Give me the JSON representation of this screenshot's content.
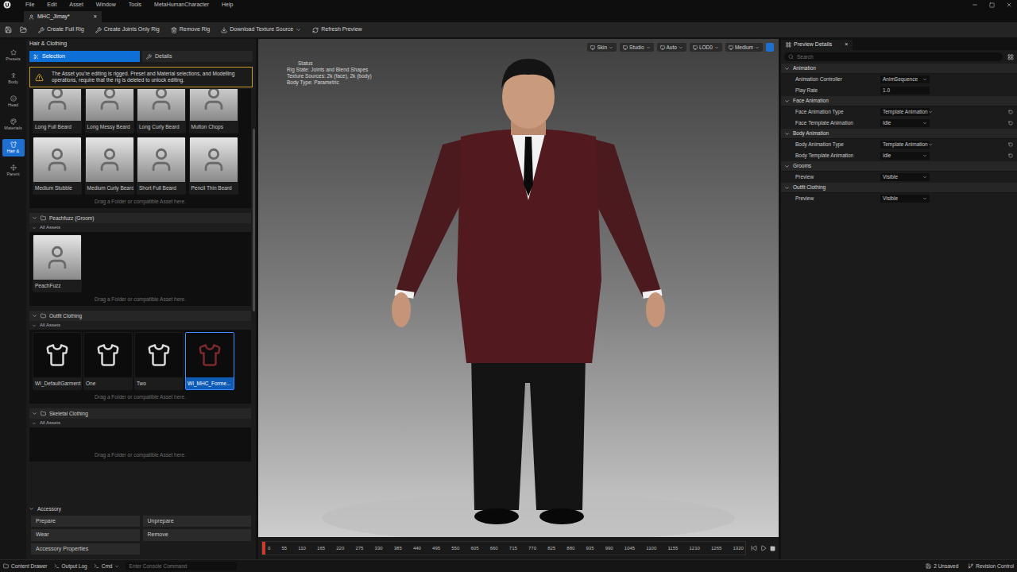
{
  "menu_bar": {
    "items": [
      "File",
      "Edit",
      "Asset",
      "Window",
      "Tools",
      "MetaHumanCharacter",
      "Help"
    ]
  },
  "document_tab": {
    "title": "MHC_Jimay*",
    "close": "×"
  },
  "toolbar": {
    "buttons": [
      {
        "label": "Create Full Rig",
        "dropdown": false
      },
      {
        "label": "Create Joints Only Rig",
        "dropdown": false
      },
      {
        "label": "Remove Rig",
        "dropdown": false
      },
      {
        "label": "Download Texture Source",
        "dropdown": true
      },
      {
        "label": "Refresh Preview",
        "dropdown": false
      }
    ]
  },
  "rail": [
    {
      "label": "Presets",
      "selected": false
    },
    {
      "label": "Body",
      "selected": false
    },
    {
      "label": "Head",
      "selected": false
    },
    {
      "label": "Materials",
      "selected": false
    },
    {
      "label": "Hair &",
      "selected": true
    },
    {
      "label": "Parent",
      "selected": false
    }
  ],
  "left_panel": {
    "title": "Hair & Clothing",
    "tabs": [
      {
        "label": "Selection",
        "selected": true
      },
      {
        "label": "Details",
        "selected": false
      }
    ],
    "warning": "The Asset you're editing is rigged. Preset and Material selections, and Modelling operations, require that the rig is deleted to unlock editing.",
    "beards": {
      "cards": [
        {
          "label": "Long Full Beard",
          "selected": false
        },
        {
          "label": "Long Messy Beard",
          "selected": false
        },
        {
          "label": "Long Curly Beard",
          "selected": false
        },
        {
          "label": "Mutton Chops",
          "selected": false
        },
        {
          "label": "Medium Stubble",
          "selected": false
        },
        {
          "label": "Medium Curly Beard",
          "selected": false
        },
        {
          "label": "Short Full Beard",
          "selected": false
        },
        {
          "label": "Pencil Thin Beard",
          "selected": false
        }
      ],
      "drop_hint": "Drag a Folder or compatible Asset here."
    },
    "sections": [
      {
        "title": "Peachfuzz (Groom)",
        "expanded": true,
        "group": "All Assets",
        "cards": [
          {
            "label": "PeachFuzz",
            "selected": false
          }
        ],
        "drop_hint": "Drag a Folder or compatible Asset here."
      },
      {
        "title": "Outfit Clothing",
        "expanded": true,
        "group": "All Assets",
        "cards": [
          {
            "label": "WI_DefaultGarment",
            "selected": false
          },
          {
            "label": "One",
            "selected": false
          },
          {
            "label": "Two",
            "selected": false
          },
          {
            "label": "WI_MHC_Forme...",
            "selected": true
          }
        ],
        "drop_hint": "Drag a Folder or compatible Asset here."
      },
      {
        "title": "Skeletal Clothing",
        "expanded": true,
        "group": "All Assets",
        "cards": [],
        "drop_hint": "Drag a Folder or compatible Asset here."
      }
    ],
    "accessory": {
      "title": "Accessory",
      "expanded": true,
      "buttons": [
        "Prepare",
        "Unprepare",
        "Wear",
        "Remove",
        "Accessory Properties"
      ]
    }
  },
  "viewport": {
    "toolbar": [
      {
        "label": "Skin"
      },
      {
        "label": "Studio"
      },
      {
        "label": "Auto"
      },
      {
        "label": "LOD0"
      },
      {
        "label": "Medium"
      }
    ],
    "status": {
      "title": "Status",
      "lines": [
        "Rig State: Joints and Blend Shapes",
        "Texture Sources: 2k (face), 2k (body)",
        "Body Type: Parametric"
      ]
    },
    "timeline": {
      "ticks": [
        "0",
        "55",
        "110",
        "165",
        "220",
        "275",
        "330",
        "385",
        "440",
        "495",
        "550",
        "605",
        "660",
        "715",
        "770",
        "825",
        "880",
        "935",
        "990",
        "1045",
        "1100",
        "1155",
        "1210",
        "1265",
        "1320"
      ],
      "level": 0.0
    }
  },
  "right_panel": {
    "tab": {
      "title": "Preview Details",
      "close": "×"
    },
    "search": {
      "placeholder": "Search"
    },
    "categories": [
      {
        "title": "Animation",
        "expanded": true,
        "rows": [
          {
            "label": "Animation Controller",
            "value": "AnimSequence",
            "kind": "dropdown",
            "resettable": false
          },
          {
            "label": "Play Rate",
            "value": "1.0",
            "kind": "number",
            "resettable": false
          }
        ]
      },
      {
        "title": "Face Animation",
        "expanded": true,
        "rows": [
          {
            "label": "Face Animation Type",
            "value": "Template Animation",
            "kind": "dropdown",
            "resettable": true
          },
          {
            "label": "Face Template Animation",
            "value": "Idle",
            "kind": "dropdown",
            "resettable": true
          }
        ]
      },
      {
        "title": "Body Animation",
        "expanded": true,
        "rows": [
          {
            "label": "Body Animation Type",
            "value": "Template Animation",
            "kind": "dropdown",
            "resettable": true
          },
          {
            "label": "Body Template Animation",
            "value": "Idle",
            "kind": "dropdown",
            "resettable": true
          }
        ]
      },
      {
        "title": "Grooms",
        "expanded": true,
        "rows": [
          {
            "label": "Preview",
            "value": "Visible",
            "kind": "dropdown",
            "resettable": false
          }
        ]
      },
      {
        "title": "Outfit Clothing",
        "expanded": true,
        "rows": [
          {
            "label": "Preview",
            "value": "Visible",
            "kind": "dropdown",
            "resettable": false
          }
        ]
      }
    ]
  },
  "status_bar": {
    "left": [
      {
        "label": "Content Drawer",
        "dropdown": false
      },
      {
        "label": "Output Log",
        "dropdown": false
      },
      {
        "label": "Cmd",
        "dropdown": true
      }
    ],
    "console": {
      "placeholder": "Enter Console Command"
    },
    "right": [
      {
        "label": "2 Unsaved"
      },
      {
        "label": "Revision Control"
      }
    ]
  }
}
